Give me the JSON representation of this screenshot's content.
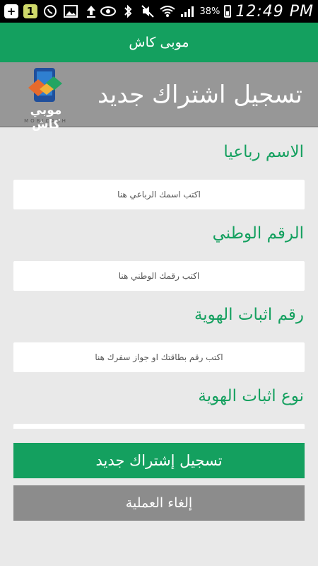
{
  "status_bar": {
    "notification_count": "1",
    "battery_percent": "38%",
    "time": "12:49 PM"
  },
  "actionbar": {
    "title": "موبى كاش"
  },
  "header": {
    "title": "تسجيل اشتراك جديد",
    "logo_text": "موبي كاش",
    "logo_sub": "MOBICASH"
  },
  "form": {
    "full_name": {
      "label": "الاسم رباعيا",
      "placeholder": "اكتب اسمك الرباعي هنا"
    },
    "national_id": {
      "label": "الرقم الوطني",
      "placeholder": "اكتب رقمك الوطني هنا"
    },
    "id_number": {
      "label": "رقم اثبات الهوية",
      "placeholder": "اكتب رقم بطاقتك او جواز سفرك هنا"
    },
    "id_type": {
      "label": "نوع اثبات الهوية"
    }
  },
  "buttons": {
    "register": "تسجيل إشتراك جديد",
    "cancel": "إلغاء العملية"
  }
}
